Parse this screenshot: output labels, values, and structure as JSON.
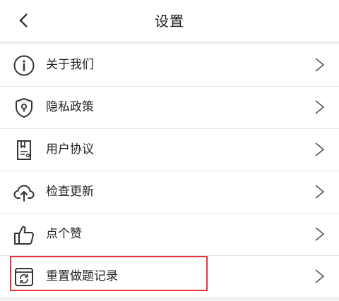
{
  "header": {
    "title": "设置",
    "back_icon": "chevron-left-icon"
  },
  "menu": {
    "items": [
      {
        "label": "关于我们",
        "icon": "info-circle-icon"
      },
      {
        "label": "隐私政策",
        "icon": "shield-lock-icon"
      },
      {
        "label": "用户协议",
        "icon": "agreement-document-icon"
      },
      {
        "label": "检查更新",
        "icon": "cloud-upload-icon"
      },
      {
        "label": "点个赞",
        "icon": "thumbs-up-icon"
      },
      {
        "label": "重置做题记录",
        "icon": "reset-record-icon"
      }
    ],
    "chevron_icon": "chevron-right-icon"
  },
  "colors": {
    "background": "#f2f2f2",
    "row": "#ffffff",
    "text": "#222222",
    "highlight": "#e8343c"
  }
}
